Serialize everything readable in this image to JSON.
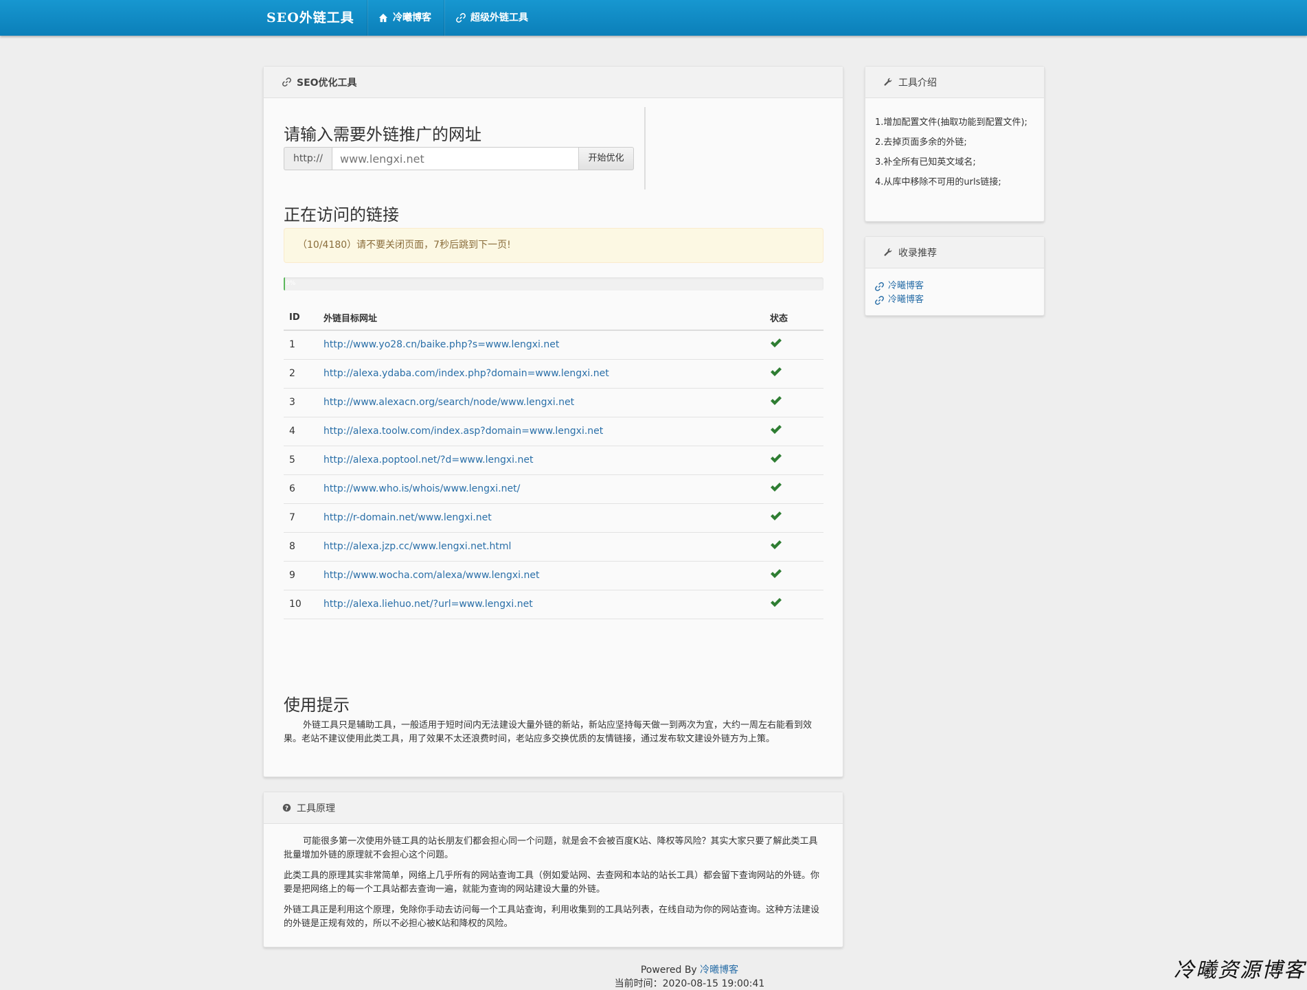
{
  "navbar": {
    "brand": "SEO外链工具",
    "items": [
      {
        "label": "冷曦博客",
        "icon": "home-icon"
      },
      {
        "label": "超级外链工具",
        "icon": "link-icon"
      }
    ]
  },
  "main_panel": {
    "heading": "SEO优化工具",
    "input_title": "请输入需要外链推广的网址",
    "url_prefix": "http://",
    "url_placeholder": "www.lengxi.net",
    "submit_label": "开始优化",
    "visiting_title": "正在访问的链接",
    "alert_text": "（10/4180）请不要关闭页面，7秒后跳到下一页!",
    "progress": {
      "value": 10,
      "total": 4180,
      "label": "0%"
    },
    "table": {
      "headers": [
        "ID",
        "外链目标网址",
        "状态"
      ],
      "rows": [
        {
          "id": "1",
          "url": "http://www.yo28.cn/baike.php?s=www.lengxi.net"
        },
        {
          "id": "2",
          "url": "http://alexa.ydaba.com/index.php?domain=www.lengxi.net"
        },
        {
          "id": "3",
          "url": "http://www.alexacn.org/search/node/www.lengxi.net"
        },
        {
          "id": "4",
          "url": "http://alexa.toolw.com/index.asp?domain=www.lengxi.net"
        },
        {
          "id": "5",
          "url": "http://alexa.poptool.net/?d=www.lengxi.net"
        },
        {
          "id": "6",
          "url": "http://www.who.is/whois/www.lengxi.net/"
        },
        {
          "id": "7",
          "url": "http://r-domain.net/www.lengxi.net"
        },
        {
          "id": "8",
          "url": "http://alexa.jzp.cc/www.lengxi.net.html"
        },
        {
          "id": "9",
          "url": "http://www.wocha.com/alexa/www.lengxi.net"
        },
        {
          "id": "10",
          "url": "http://alexa.liehuo.net/?url=www.lengxi.net"
        }
      ]
    },
    "tips_title": "使用提示",
    "tips_text": "外链工具只是辅助工具，一般适用于短时间内无法建设大量外链的新站，新站应坚持每天做一到两次为宜，大约一周左右能看到效果。老站不建议使用此类工具，用了效果不太还浪费时间，老站应多交换优质的友情链接，通过发布软文建设外链方为上策。"
  },
  "principle_panel": {
    "heading": "工具原理",
    "paragraphs": [
      "可能很多第一次使用外链工具的站长朋友们都会担心同一个问题，就是会不会被百度K站、降权等风险？其实大家只要了解此类工具批量增加外链的原理就不会担心这个问题。",
      "此类工具的原理其实非常简单，网络上几乎所有的网站查询工具（例如爱站网、去查网和本站的站长工具）都会留下查询网站的外链。你要是把网络上的每一个工具站都去查询一遍，就能为查询的网站建设大量的外链。",
      "外链工具正是利用这个原理，免除你手动去访问每一个工具站查询，利用收集到的工具站列表，在线自动为你的网站查询。这种方法建设的外链是正规有效的，所以不必担心被K站和降权的风险。"
    ]
  },
  "intro_panel": {
    "heading": "工具介绍",
    "items": [
      "1.增加配置文件(抽取功能到配置文件);",
      "2.去掉页面多余的外链;",
      "3.补全所有已知英文域名;",
      "4.从库中移除不可用的urls链接;"
    ]
  },
  "recommend_panel": {
    "heading": "收录推荐",
    "links": [
      "冷曦博客",
      "冷曦博客"
    ]
  },
  "footer": {
    "powered_prefix": "Powered By ",
    "powered_link": "冷曦博客",
    "time_text": "当前时间：2020-08-15 19:00:41"
  },
  "watermark": "冷曦资源博客",
  "colors": {
    "navbar": "#1189c4",
    "link": "#2a6fa8",
    "check": "#2e7d32",
    "alert_bg": "#fcf8e3"
  }
}
